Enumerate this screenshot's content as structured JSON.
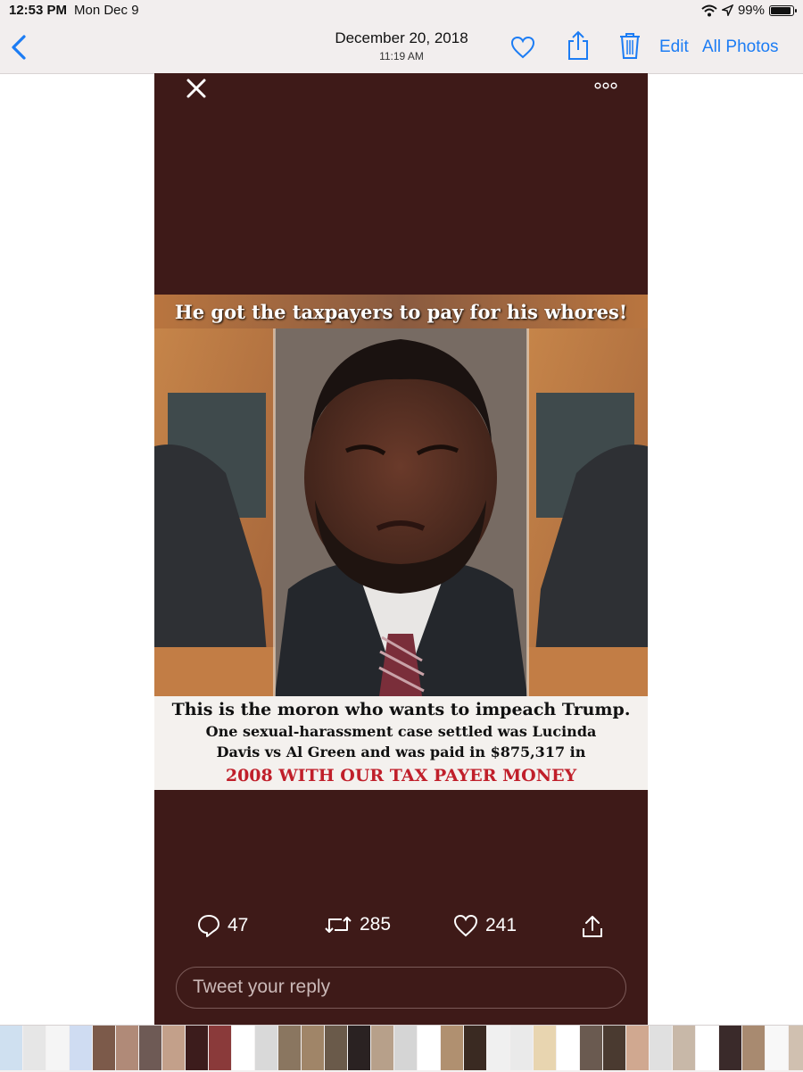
{
  "status_bar": {
    "time": "12:53 PM",
    "date": "Mon Dec 9",
    "battery": "99%",
    "battery_level": 0.99
  },
  "nav": {
    "date": "December 20, 2018",
    "time": "11:19 AM",
    "edit_label": "Edit",
    "all_photos_label": "All Photos",
    "accent_color": "#1c7cf4"
  },
  "meme": {
    "top_caption": "He got the taxpayers to pay for his whores!",
    "line1": "This is the moron who wants to impeach Trump.",
    "line2": "One sexual-harassment case settled was Lucinda",
    "line3": "Davis vs Al Green and was paid in $875,317 in",
    "line4": "2008 WITH OUR TAX PAYER MONEY"
  },
  "tweet": {
    "replies": "47",
    "retweets": "285",
    "likes": "241",
    "reply_placeholder": "Tweet your reply",
    "background_color": "#3e1a18"
  },
  "icons": {
    "back": "chevron-left-icon",
    "favorite": "heart-icon",
    "share": "share-icon",
    "delete": "trash-icon",
    "close": "close-icon",
    "more": "more-icon",
    "reply": "speech-bubble-icon",
    "retweet": "retweet-icon",
    "like": "heart-icon",
    "tweet_share": "upload-icon"
  },
  "thumbnails": [
    "#cfe0f0",
    "#e6e6e6",
    "#f5f5f5",
    "#cfdcf2",
    "#7c5a4a",
    "#b08a78",
    "#6e5a55",
    "#c3a08a",
    "#3c1c1c",
    "#8a3a3a",
    "#ffffff",
    "#d9d9d9",
    "#8a7660",
    "#a08568",
    "#6a5a4a",
    "#2a2222",
    "#b7a08a",
    "#d5d5d5",
    "#ffffff",
    "#b09070",
    "#3a2a22",
    "#f0f0f0",
    "#eaeaea",
    "#e8d5b0",
    "#ffffff",
    "#6a5a50",
    "#4a3a30",
    "#d0a890",
    "#e0e0e0",
    "#c8b8a8",
    "#ffffff",
    "#3a2a2a",
    "#a88a70",
    "#f8f8f8",
    "#d0c0b0",
    "#8a8a8a",
    "#e0d0c0",
    "#b8a898"
  ]
}
